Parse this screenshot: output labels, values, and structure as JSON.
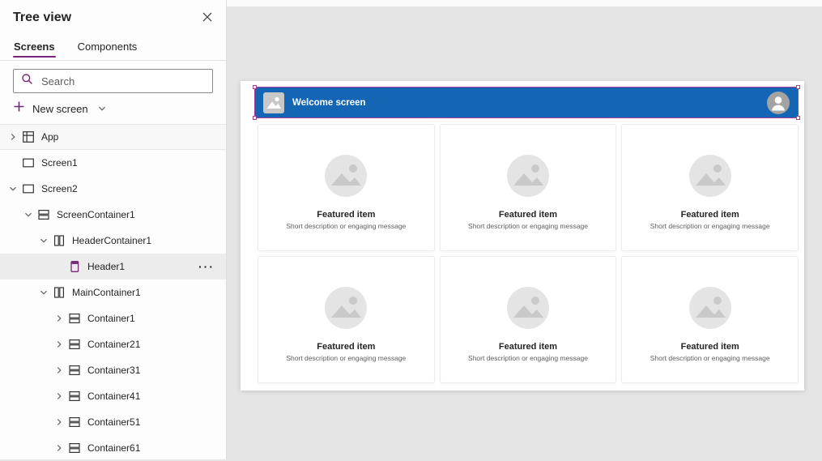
{
  "colors": {
    "accent_purple": "#742774",
    "selection_purple": "#a33e97",
    "header_blue": "#1465b4",
    "canvas_gray": "#e5e5e5",
    "selected_row_gray": "#ececec"
  },
  "panel": {
    "title": "Tree view",
    "close_icon": "close-icon",
    "tabs": [
      {
        "label": "Screens",
        "active": true
      },
      {
        "label": "Components",
        "active": false
      }
    ],
    "search": {
      "placeholder": "Search",
      "icon": "search-icon"
    },
    "new_screen": {
      "label": "New screen",
      "icon": "plus-icon",
      "chevron": "chevron-down-icon"
    },
    "more_glyph": "···",
    "tree": [
      {
        "label": "App",
        "icon": "app-icon",
        "state": "collapsed"
      },
      {
        "label": "Screen1",
        "icon": "screen-icon",
        "state": "leaf"
      },
      {
        "label": "Screen2",
        "icon": "screen-icon",
        "state": "expanded"
      },
      {
        "label": "ScreenContainer1",
        "icon": "horizontal-container-icon",
        "state": "expanded"
      },
      {
        "label": "HeaderContainer1",
        "icon": "vertical-container-icon",
        "state": "expanded"
      },
      {
        "label": "Header1",
        "icon": "header-icon",
        "state": "leaf",
        "selected": true
      },
      {
        "label": "MainContainer1",
        "icon": "vertical-container-icon",
        "state": "expanded"
      },
      {
        "label": "Container1",
        "icon": "horizontal-container-icon",
        "state": "collapsed"
      },
      {
        "label": "Container21",
        "icon": "horizontal-container-icon",
        "state": "collapsed"
      },
      {
        "label": "Container31",
        "icon": "horizontal-container-icon",
        "state": "collapsed"
      },
      {
        "label": "Container41",
        "icon": "horizontal-container-icon",
        "state": "collapsed"
      },
      {
        "label": "Container51",
        "icon": "horizontal-container-icon",
        "state": "collapsed"
      },
      {
        "label": "Container61",
        "icon": "horizontal-container-icon",
        "state": "collapsed"
      }
    ]
  },
  "canvas": {
    "header": {
      "title": "Welcome screen",
      "left_icon": "image-placeholder-icon",
      "right_icon": "person-icon"
    },
    "cards": [
      {
        "title": "Featured item",
        "subtitle": "Short description or engaging message",
        "icon": "image-placeholder-icon"
      },
      {
        "title": "Featured item",
        "subtitle": "Short description or engaging message",
        "icon": "image-placeholder-icon"
      },
      {
        "title": "Featured item",
        "subtitle": "Short description or engaging message",
        "icon": "image-placeholder-icon"
      },
      {
        "title": "Featured item",
        "subtitle": "Short description or engaging message",
        "icon": "image-placeholder-icon"
      },
      {
        "title": "Featured item",
        "subtitle": "Short description or engaging message",
        "icon": "image-placeholder-icon"
      },
      {
        "title": "Featured item",
        "subtitle": "Short description or engaging message",
        "icon": "image-placeholder-icon"
      }
    ]
  }
}
